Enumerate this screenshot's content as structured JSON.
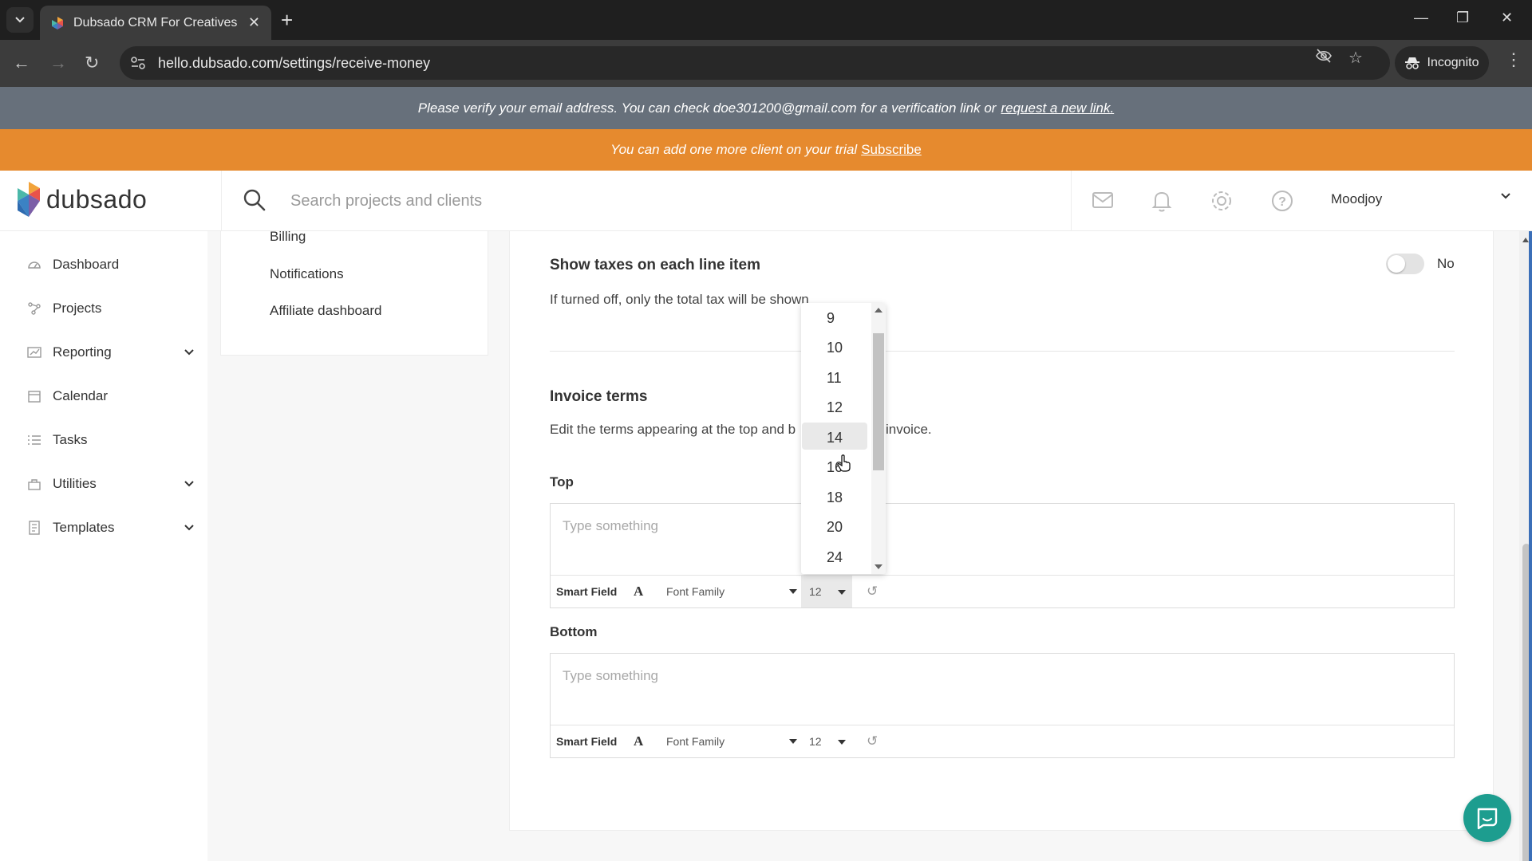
{
  "browser": {
    "tab_title": "Dubsado CRM For Creatives",
    "url": "hello.dubsado.com/settings/receive-money",
    "incognito_label": "Incognito"
  },
  "banners": {
    "verify_text": "Please verify your email address. You can check doe301200@gmail.com for a verification link or",
    "verify_link": "request a new link.",
    "trial_text": "You can add one more client on your trial",
    "trial_link": "Subscribe"
  },
  "header": {
    "logo_text": "dubsado",
    "search_placeholder": "Search projects and clients",
    "user_name": "Moodjoy"
  },
  "sidebar": {
    "items": [
      {
        "label": "Dashboard"
      },
      {
        "label": "Projects"
      },
      {
        "label": "Reporting"
      },
      {
        "label": "Calendar"
      },
      {
        "label": "Tasks"
      },
      {
        "label": "Utilities"
      },
      {
        "label": "Templates"
      }
    ]
  },
  "settings_menu": {
    "items": [
      {
        "label": "Billing"
      },
      {
        "label": "Notifications"
      },
      {
        "label": "Affiliate dashboard"
      }
    ]
  },
  "taxes": {
    "title": "Show taxes on each line item",
    "description": "If turned off, only the total tax will be shown",
    "toggle_value": "No"
  },
  "invoice_terms": {
    "title": "Invoice terms",
    "description_start": "Edit the terms appearing at the top and b",
    "description_end": "invoice.",
    "top_label": "Top",
    "bottom_label": "Bottom",
    "placeholder": "Type something",
    "smart_field": "Smart Field",
    "font_family": "Font Family",
    "font_size_top": "12",
    "font_size_bottom": "12"
  },
  "font_size_dropdown": {
    "options": [
      "9",
      "10",
      "11",
      "12",
      "14",
      "16",
      "18",
      "20",
      "24"
    ],
    "highlighted": "14"
  },
  "colors": {
    "verify_banner": "#67707b",
    "trial_banner": "#e68a2e",
    "chat_button": "#1d9d8f"
  }
}
